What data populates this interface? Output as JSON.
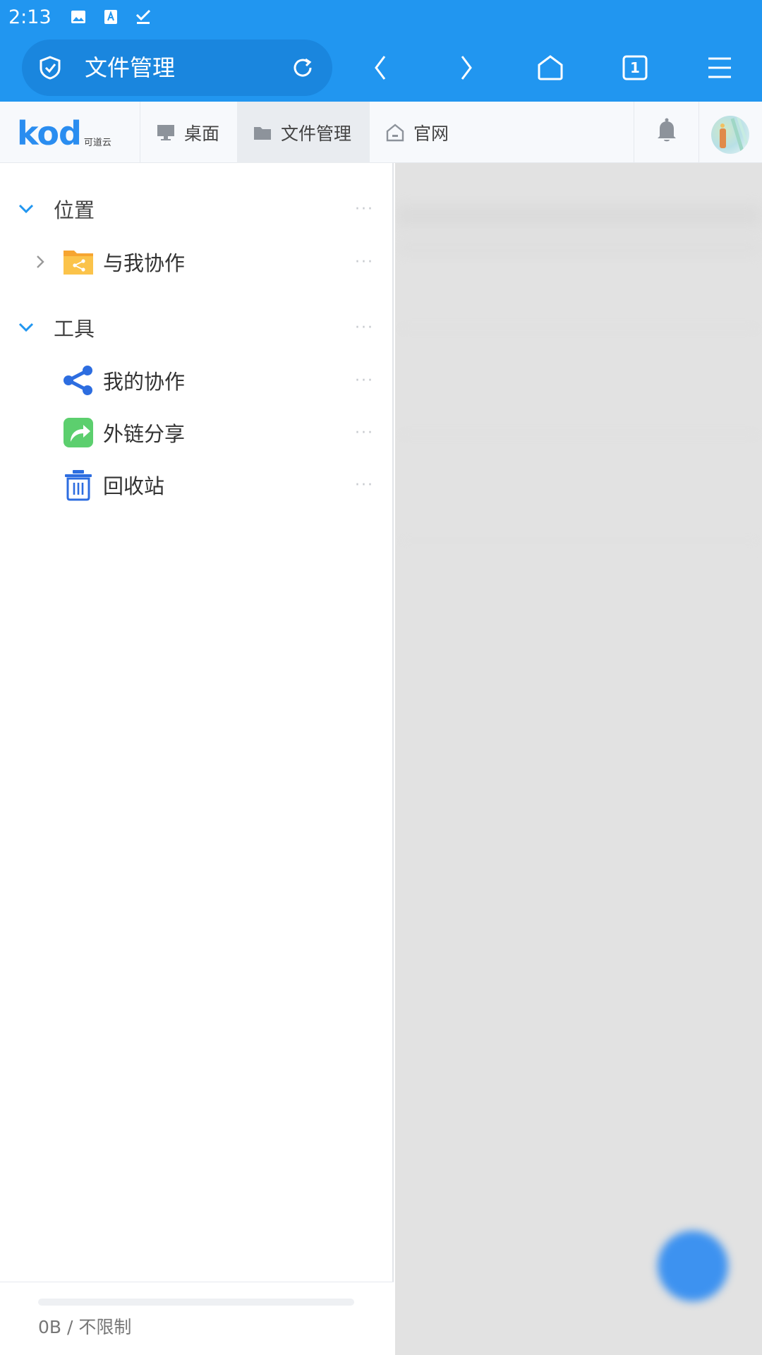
{
  "status_bar": {
    "time": "2:13",
    "icons": [
      "image-icon",
      "text-recognition-icon",
      "check-download-icon"
    ]
  },
  "browser": {
    "url_title": "文件管理",
    "tab_count": "1",
    "icons": [
      "shield-check-icon",
      "reload-icon",
      "back-icon",
      "forward-icon",
      "home-icon",
      "tabs-icon",
      "menu-icon"
    ]
  },
  "app_header": {
    "logo_text": "kod",
    "logo_sub": "可道云",
    "tabs": [
      {
        "label": "桌面",
        "icon": "desktop-icon",
        "active": false
      },
      {
        "label": "文件管理",
        "icon": "folder-icon",
        "active": true
      },
      {
        "label": "官网",
        "icon": "home-outline-icon",
        "active": false
      }
    ]
  },
  "sidebar": {
    "groups": [
      {
        "label": "位置",
        "items": [
          {
            "label": "与我协作",
            "icon": "shared-folder-icon",
            "expandable": true
          }
        ]
      },
      {
        "label": "工具",
        "items": [
          {
            "label": "我的协作",
            "icon": "share-nodes-icon",
            "expandable": false
          },
          {
            "label": "外链分享",
            "icon": "external-share-icon",
            "expandable": false
          },
          {
            "label": "回收站",
            "icon": "trash-icon",
            "expandable": false
          }
        ]
      }
    ],
    "more_label": "···",
    "storage": {
      "text": "0B / 不限制",
      "used_fraction": 0
    }
  },
  "colors": {
    "accent": "#2196f0",
    "folder": "#f9b93a",
    "share_green": "#5ccf6e"
  }
}
